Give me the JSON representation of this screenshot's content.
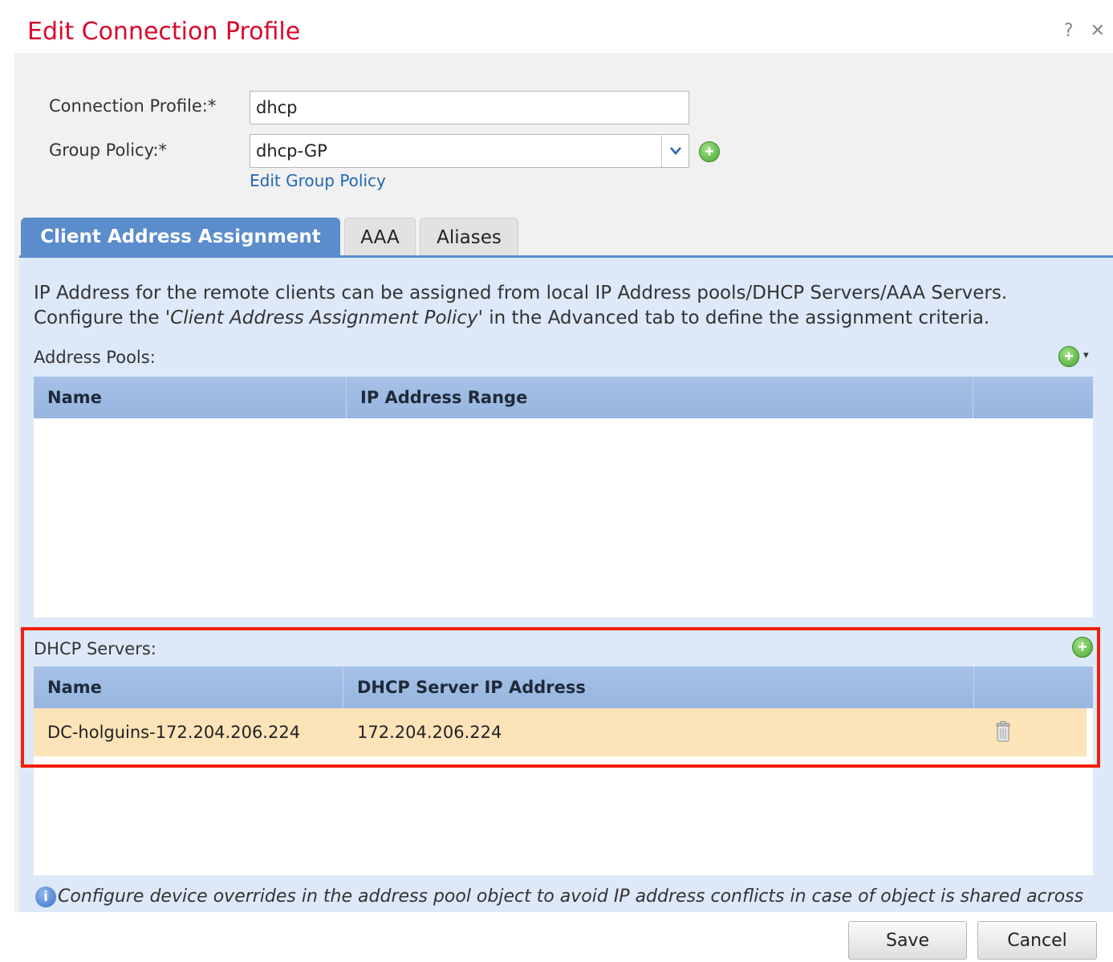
{
  "dialog": {
    "title": "Edit Connection Profile",
    "help_label": "?",
    "close_label": "✕"
  },
  "form": {
    "connection_profile_label": "Connection Profile:*",
    "connection_profile_value": "dhcp",
    "group_policy_label": "Group Policy:*",
    "group_policy_value": "dhcp-GP",
    "edit_group_policy_link": "Edit Group Policy"
  },
  "tabs": [
    {
      "label": "Client Address Assignment",
      "active": true
    },
    {
      "label": "AAA",
      "active": false
    },
    {
      "label": "Aliases",
      "active": false
    }
  ],
  "client_address": {
    "description_line1": "IP Address for the remote clients can be assigned from local IP Address pools/DHCP Servers/AAA Servers.",
    "description_line2_prefix": "Configure the ",
    "description_line2_italic": "'Client Address Assignment Policy'",
    "description_line2_suffix": " in the Advanced tab to define the assignment criteria.",
    "address_pools": {
      "label": "Address Pools:",
      "columns": [
        "Name",
        "IP Address Range"
      ],
      "rows": []
    },
    "dhcp_servers": {
      "label": "DHCP Servers:",
      "columns": [
        "Name",
        "DHCP Server IP Address"
      ],
      "rows": [
        {
          "name": "DC-holguins-172.204.206.224",
          "ip": "172.204.206.224"
        }
      ]
    },
    "info_text": "Configure device overrides in the address pool object to avoid IP address conflicts in case of object is shared across"
  },
  "buttons": {
    "save": "Save",
    "cancel": "Cancel"
  },
  "colors": {
    "title": "#d9082a",
    "tab_active": "#5b8ccc",
    "panel": "#dde8f8",
    "row_selected": "#fce3b8",
    "highlight_border": "#f21e0c"
  }
}
